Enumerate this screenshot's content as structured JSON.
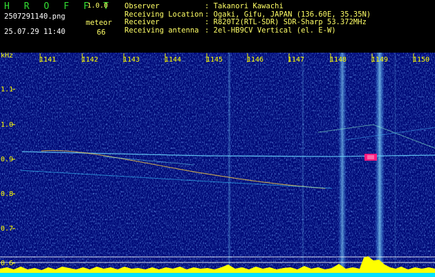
{
  "header": {
    "app_name": "H R O F F T",
    "app_version": "1.0.0",
    "filename": "2507291140.png",
    "datetime": "25.07.29 11:40",
    "meteor_label": "meteor",
    "meteor_count": "66",
    "info": [
      {
        "key": "Observer",
        "value": ": Takanori Kawachi"
      },
      {
        "key": "Receiving Location",
        "value": ": Ogaki, Gifu, JAPAN (136.60E, 35.35N)"
      },
      {
        "key": "Receiver",
        "value": ": R820T2(RTL-SDR) SDR-Sharp 53.372MHz"
      },
      {
        "key": "Receiving antenna",
        "value": ": 2el-HB9CV Vertical (el. E-W)"
      }
    ]
  },
  "spectrogram": {
    "y_unit": "kHz",
    "y_ticks": [
      "1.1",
      "1.0",
      "0.9",
      "0.8",
      "0.7",
      "0.6"
    ],
    "x_ticks": [
      "1141",
      "1142",
      "1143",
      "1144",
      "1145",
      "1146",
      "1147",
      "1148",
      "1149",
      "1150"
    ],
    "colors": {
      "background": "#000080",
      "signal": "#00ffff",
      "peak": "#ff0066",
      "level": "#ffff00",
      "axis": "#ffff00"
    }
  }
}
